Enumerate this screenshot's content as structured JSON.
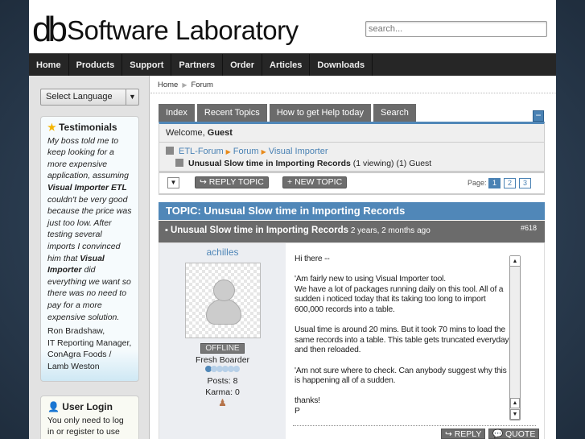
{
  "header": {
    "logo_mark": "db",
    "logo_text": "Software Laboratory",
    "search_placeholder": "search..."
  },
  "nav": [
    "Home",
    "Products",
    "Support",
    "Partners",
    "Order",
    "Articles",
    "Downloads"
  ],
  "sidebar": {
    "language": "Select Language",
    "testimonials": {
      "title": "Testimonials",
      "q1": "My boss told me to keep looking for a more expensive application, assuming ",
      "b1": "Visual Importer ETL",
      "q2": " couldn't be very good because the price was just too low.  After testing several imports I convinced him that ",
      "b2": "Visual Importer",
      "q3": " did everything we want so there was no need to pay for a more expensive solution.",
      "author": "Ron Bradshaw,",
      "role": "IT Reporting Manager,",
      "company": "ConAgra Foods / Lamb Weston"
    },
    "login": {
      "title": "User Login",
      "text": "You only need to log in or register to use our"
    }
  },
  "breadcrumb": [
    "Home",
    "Forum"
  ],
  "tabs": [
    "Index",
    "Recent Topics",
    "How to get Help today",
    "Search"
  ],
  "welcome": {
    "prefix": "Welcome, ",
    "user": "Guest"
  },
  "path": {
    "items": [
      "ETL-Forum",
      "Forum",
      "Visual Importer"
    ],
    "topic": "Unusual Slow time in Importing Records",
    "viewing": " (1 viewing) (1) Guest"
  },
  "actions": {
    "reply": "REPLY TOPIC",
    "new": "NEW TOPIC",
    "page_label": "Page:",
    "pages": [
      "1",
      "2",
      "3"
    ]
  },
  "topic_title": "TOPIC: Unusual Slow time in Importing Records",
  "post": {
    "title": "Unusual Slow time in Importing Records",
    "ago": " 2 years, 2 months ago",
    "num": "#618",
    "user": "achilles",
    "status": "OFFLINE",
    "rank": "Fresh Boarder",
    "posts": "Posts: 8",
    "karma": "Karma: 0",
    "body": "Hi there --\n\n'Am fairly new to using Visual Importer tool.\nWe have a lot of packages running daily on this tool. All of a sudden i noticed today that its taking too long to import 600,000 records into a table.\n\nUsual time is around 20 mins. But it took 70 mins to load the same records into a table. This table gets truncated everyday and then reloaded.\n\n'Am not sure where to check. Can anybody suggest why this is happening all of a sudden.\n\nthanks!\nP",
    "reply": "REPLY",
    "quote": "QUOTE"
  }
}
